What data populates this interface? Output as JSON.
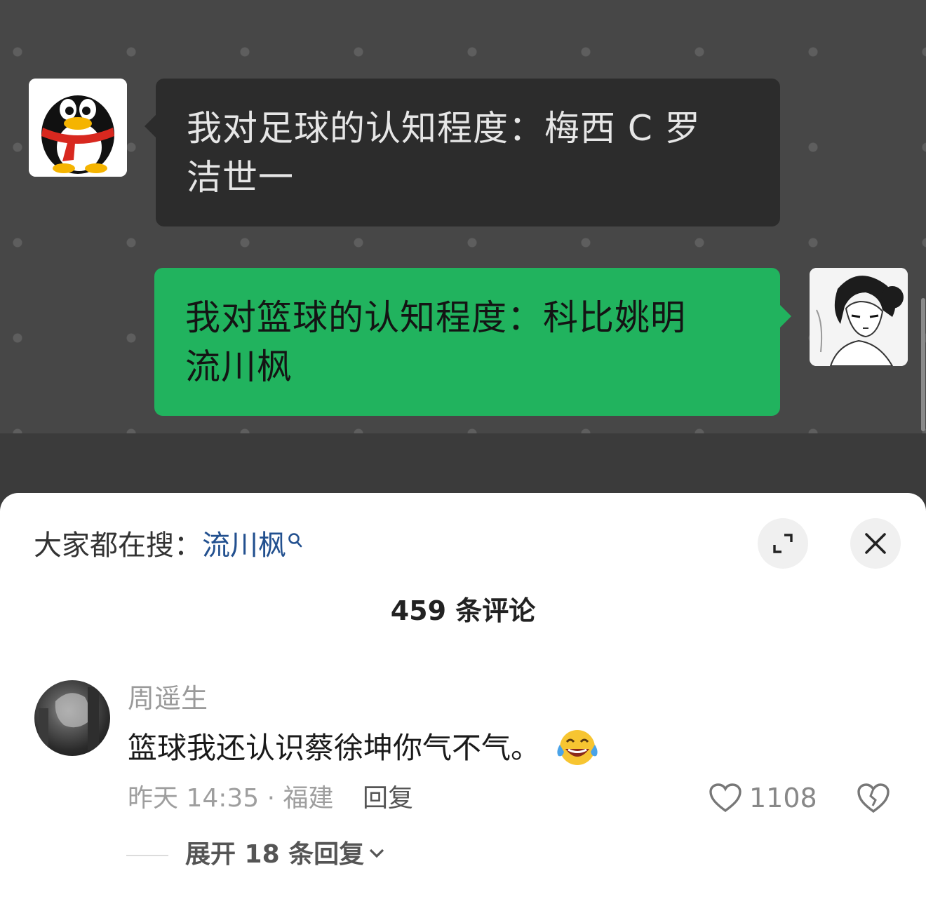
{
  "chat": {
    "left_message": {
      "line1": "我对足球的认知程度：梅西 C 罗",
      "line2": "洁世一"
    },
    "right_message": {
      "line1": "我对篮球的认知程度：科比姚明",
      "line2": "流川枫"
    }
  },
  "sheet": {
    "search_prefix": "大家都在搜：",
    "search_keyword": "流川枫",
    "comment_count_title": "459 条评论",
    "comment": {
      "username": "周遥生",
      "text": "篮球我还认识蔡徐坤你气不气。",
      "emoji": "laughing-tears-emoji",
      "meta": "昨天 14:35 · 福建",
      "reply_label": "回复",
      "like_count": "1108",
      "expand_replies_label": "展开 18 条回复"
    }
  },
  "colors": {
    "green_bubble": "#21b35e",
    "dark_bubble": "#2c2c2c",
    "link_blue": "#22508f"
  }
}
